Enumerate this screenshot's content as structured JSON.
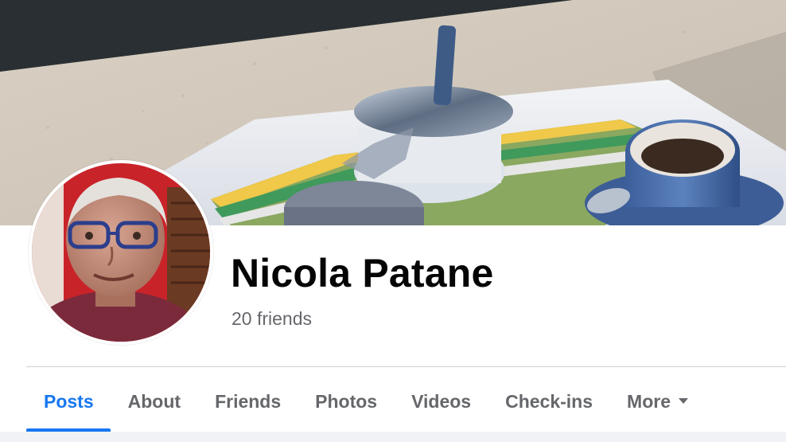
{
  "profile": {
    "name": "Nicola Patane",
    "friends": "20 friends"
  },
  "tabs": [
    {
      "label": "Posts",
      "active": true
    },
    {
      "label": "About",
      "active": false
    },
    {
      "label": "Friends",
      "active": false
    },
    {
      "label": "Photos",
      "active": false
    },
    {
      "label": "Videos",
      "active": false
    },
    {
      "label": "Check-ins",
      "active": false
    },
    {
      "label": "More",
      "active": false
    }
  ],
  "colors": {
    "accent": "#1877f2",
    "text_primary": "#050505",
    "text_secondary": "#65676b",
    "divider": "#ced0d4"
  },
  "icons": {
    "more_caret": "caret-down-icon"
  }
}
